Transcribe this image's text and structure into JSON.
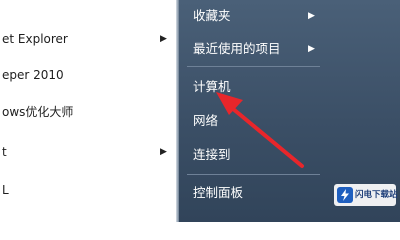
{
  "left_menu": {
    "items": [
      {
        "label": "et Explorer",
        "has_submenu": true
      },
      {
        "label": "eper 2010",
        "has_submenu": false
      },
      {
        "label": "ows优化大师",
        "has_submenu": false
      },
      {
        "label": "t",
        "has_submenu": true
      },
      {
        "label": "L",
        "has_submenu": false
      }
    ]
  },
  "right_menu": {
    "items": [
      {
        "label": "收藏夹",
        "has_submenu": true
      },
      {
        "label": "最近使用的项目",
        "has_submenu": true
      },
      {
        "label": "计算机",
        "has_submenu": false
      },
      {
        "label": "网络",
        "has_submenu": false
      },
      {
        "label": "连接到",
        "has_submenu": false
      },
      {
        "label": "控制面板",
        "has_submenu": false
      }
    ]
  },
  "annotation": {
    "type": "red-arrow",
    "color": "#e8262b",
    "points_to": "计算机"
  },
  "watermark": {
    "text": "闪电下载站",
    "icon": "lightning-logo-icon"
  },
  "colors": {
    "start_menu_right": "#3b4f66",
    "arrow": "#e8262b"
  }
}
